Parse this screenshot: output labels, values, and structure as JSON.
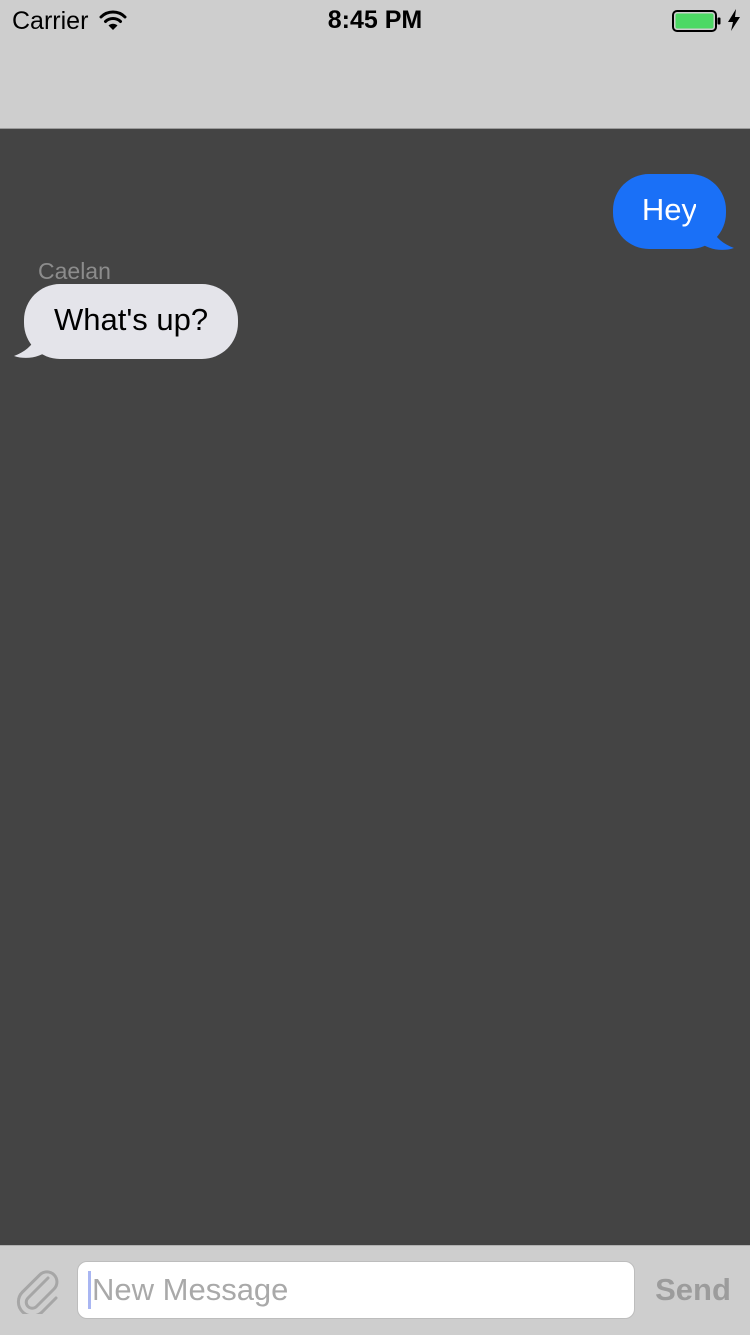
{
  "status_bar": {
    "carrier": "Carrier",
    "time": "8:45 PM",
    "battery_color": "#4cd964"
  },
  "messages": [
    {
      "direction": "outgoing",
      "text": "Hey",
      "bubble_color": "#1a70f7"
    },
    {
      "direction": "incoming",
      "sender": "Caelan",
      "text": "What's up?",
      "bubble_color": "#e4e4ea"
    }
  ],
  "input_bar": {
    "attach_icon": "paperclip-icon",
    "placeholder": "New Message",
    "value": "",
    "send_label": "Send"
  }
}
